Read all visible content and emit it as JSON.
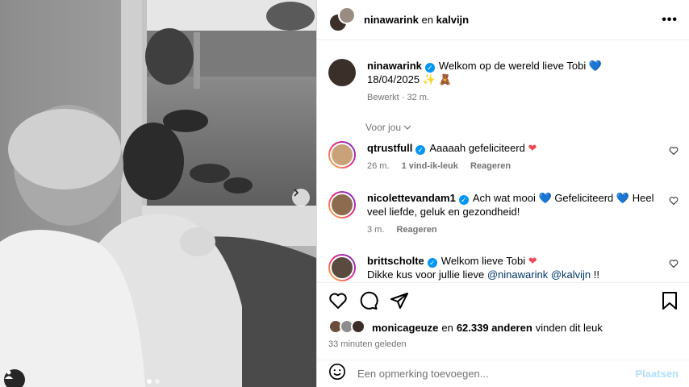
{
  "header": {
    "user1": "ninawarink",
    "conj": "en",
    "user2": "kalvijn",
    "more": "•••"
  },
  "caption": {
    "user": "ninawarink",
    "text": "Welkom op de wereld lieve Tobi",
    "heart": "💙",
    "line2": "18/04/2025 ✨ 🧸",
    "edited": "Bewerkt · 32 m."
  },
  "filter": {
    "label": "Voor jou"
  },
  "comments": [
    {
      "user": "qtrustfull",
      "text": "Aaaaah gefeliciteerd",
      "heart": "❤",
      "time": "26 m.",
      "likes": "1 vind-ik-leuk",
      "reply": "Reageren"
    },
    {
      "user": "nicolettevandam1",
      "text_a": "Ach wat mooi",
      "heart_a": "💙",
      "text_b": "Gefeliciteerd",
      "heart_b": "💙",
      "text_c": "Heel veel liefde, geluk en gezondheid!",
      "time": "3 m.",
      "reply": "Reageren"
    },
    {
      "user": "brittscholte",
      "text": "Welkom lieve Tobi",
      "heart": "❤",
      "line2_prefix": "Dikke kus voor jullie lieve",
      "mention1": "@ninawarink",
      "mention2": "@kalvijn",
      "line2_suffix": "!!"
    }
  ],
  "likes": {
    "user": "monicageuze",
    "middle": "en",
    "count": "62.339 anderen",
    "suffix": "vinden dit leuk",
    "when": "33 minuten geleden"
  },
  "composer": {
    "placeholder": "Een opmerking toevoegen...",
    "post": "Plaatsen"
  },
  "icons": {
    "like": "heart-icon",
    "comment": "comment-icon",
    "share": "share-icon",
    "save": "bookmark-icon",
    "emoji": "emoji-icon",
    "tag": "user-tag-icon",
    "next": "chevron-right-icon"
  },
  "colors": {
    "verified": "#0095f6",
    "link": "#00376b",
    "muted": "#737373",
    "post_disabled": "#b2dffc"
  }
}
